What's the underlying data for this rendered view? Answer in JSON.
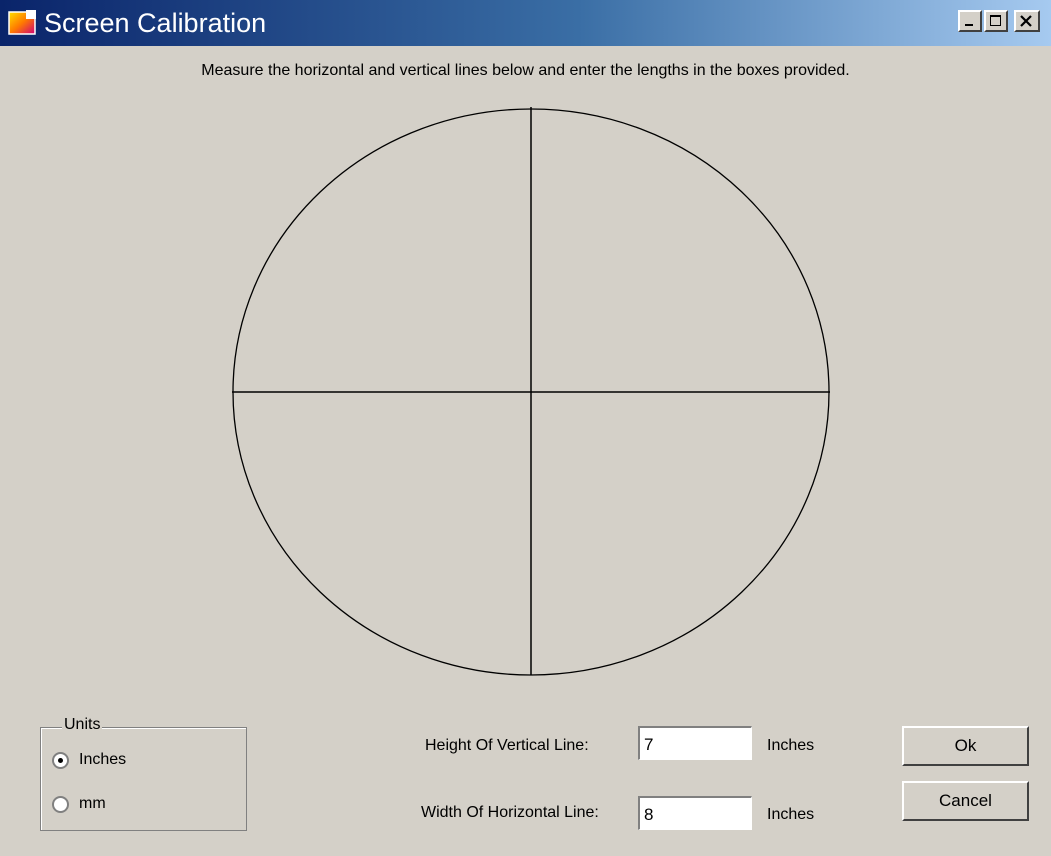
{
  "window": {
    "title": "Screen Calibration",
    "controls": {
      "minimize": "minimize-icon",
      "maximize": "maximize-icon",
      "close": "close-icon"
    }
  },
  "instruction": "Measure the horizontal and vertical lines below and enter the lengths in the boxes provided.",
  "units_group": {
    "legend": "Units",
    "options": [
      {
        "label": "Inches",
        "selected": true
      },
      {
        "label": "mm",
        "selected": false
      }
    ]
  },
  "fields": {
    "height": {
      "label": "Height Of Vertical Line:",
      "value": "7",
      "unit": "Inches"
    },
    "width": {
      "label": "Width Of Horizontal Line:",
      "value": "8",
      "unit": "Inches"
    }
  },
  "buttons": {
    "ok": "Ok",
    "cancel": "Cancel"
  },
  "colors": {
    "title_gradient_start": "#0a246a",
    "title_gradient_end": "#a6caf0",
    "face": "#d4d0c8"
  }
}
